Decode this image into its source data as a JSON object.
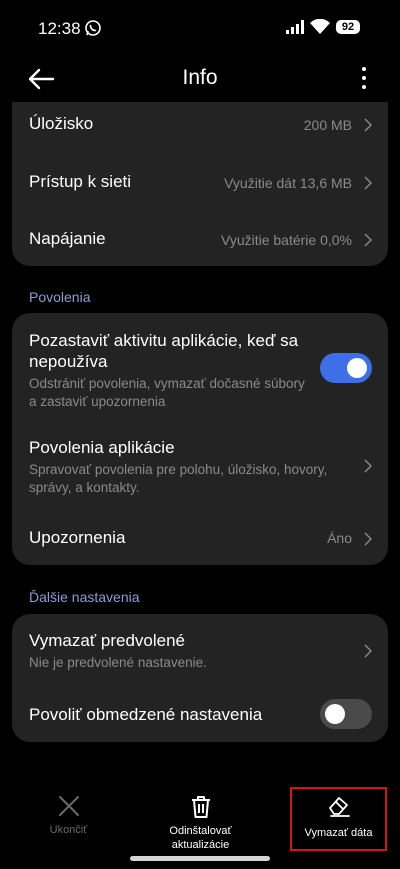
{
  "status_bar": {
    "time": "12:38",
    "battery": "92",
    "icons": [
      "whatsapp-icon",
      "signal-icon",
      "wifi-icon",
      "battery-icon"
    ]
  },
  "header": {
    "title": "Info",
    "back_icon": "arrow-left-icon",
    "menu_icon": "more-vertical-icon"
  },
  "top_card": {
    "items": [
      {
        "title": "Úložisko",
        "value": "200 MB"
      },
      {
        "title": "Prístup k sieti",
        "value": "Využitie dát 13,6 MB"
      },
      {
        "title": "Napájanie",
        "value": "Využitie batérie 0,0%"
      }
    ]
  },
  "permissions": {
    "section_label": "Povolenia",
    "pause": {
      "title_line1": "Pozastaviť aktivitu aplikácie, keď sa",
      "title_line2": "nepoužíva",
      "subtitle_line1": "Odstrániť povolenia, vymazať dočasné súbory",
      "subtitle_line2": "a zastaviť upozornenia",
      "toggle_on": true
    },
    "app_permissions": {
      "title": "Povolenia aplikácie",
      "subtitle_line1": "Spravovať povolenia pre polohu, úložisko, hovory,",
      "subtitle_line2": "správy, a kontakty."
    },
    "notifications": {
      "title": "Upozornenia",
      "value": "Áno"
    }
  },
  "more_settings": {
    "section_label": "Ďalšie nastavenia",
    "clear_defaults": {
      "title": "Vymazať predvolené",
      "subtitle": "Nie je predvolené nastavenie."
    },
    "restricted": {
      "title": "Povoliť obmedzené nastavenia",
      "toggle_on": false
    }
  },
  "bottom_actions": {
    "stop": {
      "label": "Ukončiť",
      "icon": "close-icon",
      "enabled": false
    },
    "uninstall": {
      "label_line1": "Odinštalovať",
      "label_line2": "aktualizácie",
      "icon": "trash-icon",
      "enabled": true
    },
    "clear_data": {
      "label": "Vymazať dáta",
      "icon": "eraser-icon",
      "enabled": true,
      "highlighted": true
    }
  },
  "colors": {
    "background": "#000000",
    "card": "#232323",
    "section_label": "#8f9bd8",
    "toggle_on": "#3d6fe8",
    "toggle_off": "#4a4a4a",
    "highlight": "#d11414",
    "secondary_text": "#8a8a8a",
    "disabled_text": "#6a6a6a"
  }
}
